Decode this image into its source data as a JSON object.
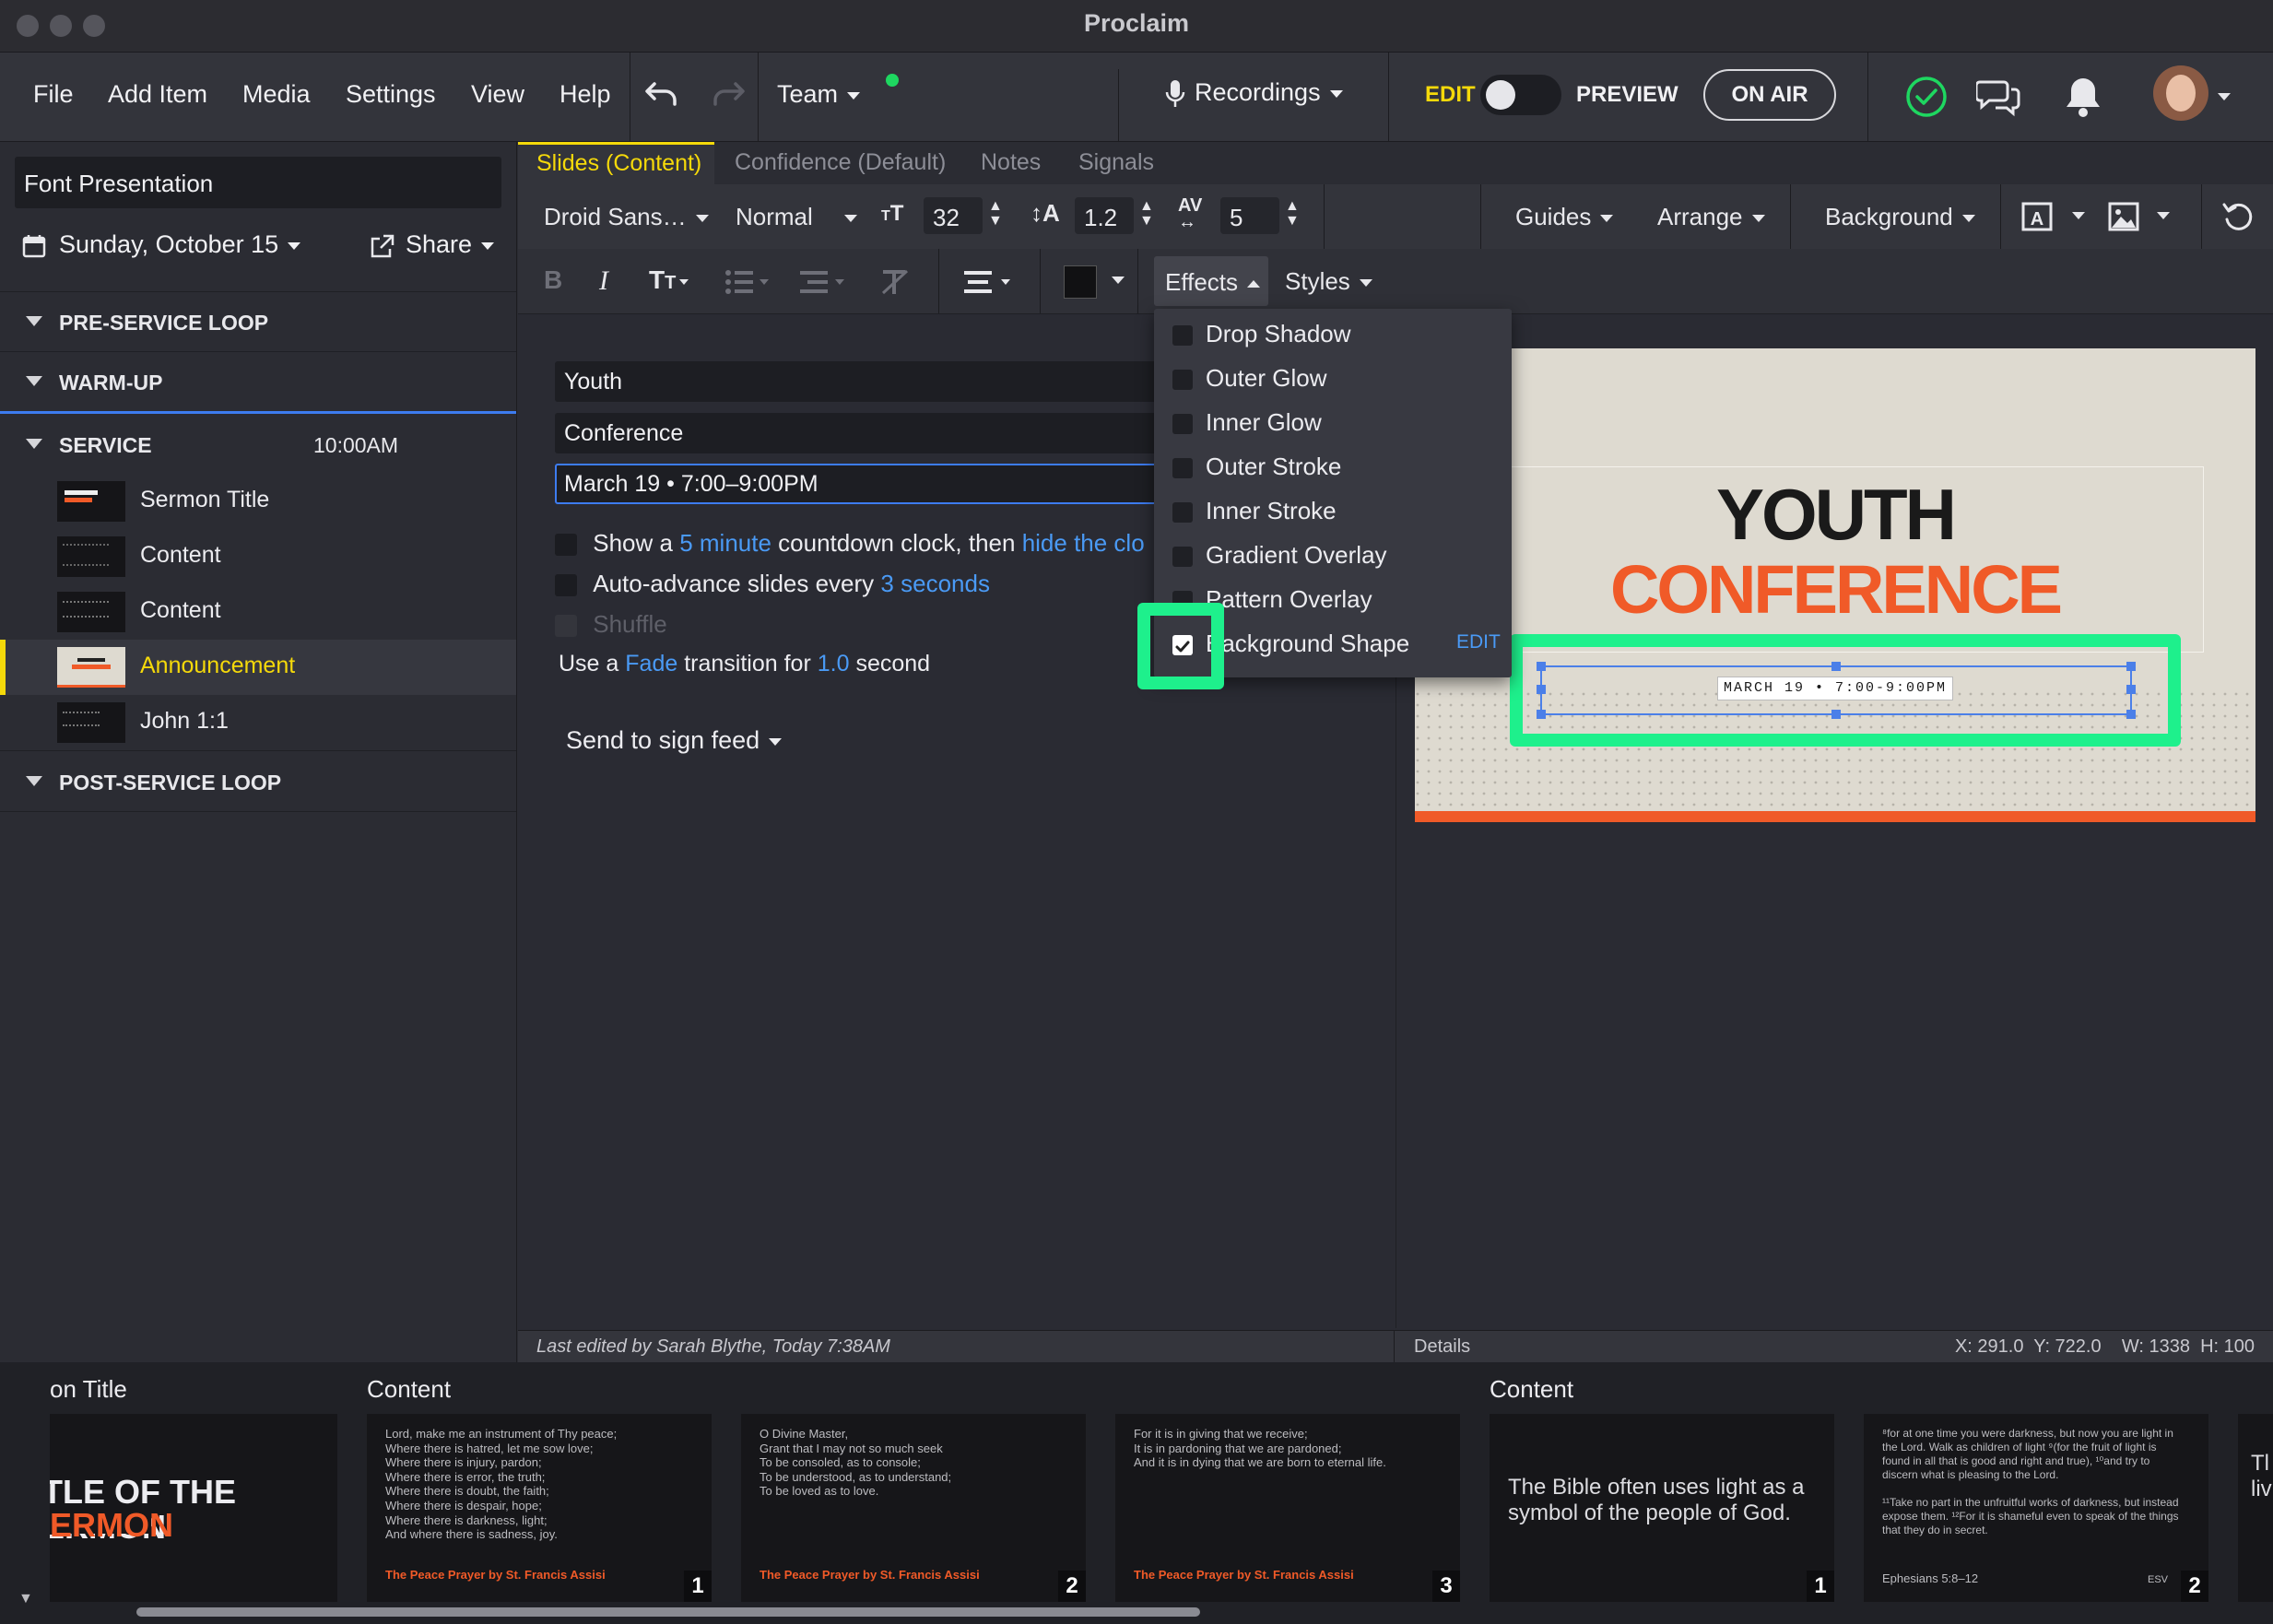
{
  "app": {
    "title": "Proclaim"
  },
  "menu": {
    "items": [
      "File",
      "Add Item",
      "Media",
      "Settings",
      "View",
      "Help"
    ],
    "team_label": "Team",
    "recordings_label": "Recordings",
    "edit_label": "EDIT",
    "preview_label": "PREVIEW",
    "on_air_label": "ON AIR"
  },
  "sidebar": {
    "presentation_name": "Font Presentation",
    "date_label": "Sunday, October 15",
    "share_label": "Share",
    "sections": [
      {
        "label": "PRE-SERVICE LOOP"
      },
      {
        "label": "WARM-UP"
      },
      {
        "label": "SERVICE",
        "time": "10:00AM"
      },
      {
        "label": "POST-SERVICE LOOP"
      }
    ],
    "service_items": [
      {
        "label": "Sermon Title",
        "selected": false
      },
      {
        "label": "Content",
        "selected": false
      },
      {
        "label": "Content",
        "selected": false
      },
      {
        "label": "Announcement",
        "selected": true
      },
      {
        "label": "John 1:1",
        "selected": false
      }
    ]
  },
  "tabs": [
    {
      "label": "Slides (Content)",
      "active": true
    },
    {
      "label": "Confidence (Default)",
      "active": false
    },
    {
      "label": "Notes",
      "active": false
    },
    {
      "label": "Signals",
      "active": false
    }
  ],
  "toolbar": {
    "font_family": "Droid Sans…",
    "font_weight": "Normal",
    "font_size": "32",
    "line_height": "1.2",
    "letter_spacing": "5",
    "guides_label": "Guides",
    "arrange_label": "Arrange",
    "background_label": "Background",
    "effects_label": "Effects",
    "styles_label": "Styles"
  },
  "editor": {
    "fields": [
      "Youth",
      "Conference",
      "March 19 • 7:00–9:00PM"
    ],
    "countdown": {
      "prefix": "Show a",
      "minutes_link": "5 minute",
      "middle": "countdown clock, then",
      "action_link": "hide the clo"
    },
    "auto_advance": {
      "prefix": "Auto-advance slides every",
      "seconds_link": "3 seconds"
    },
    "shuffle_label": "Shuffle",
    "transition": {
      "prefix": "Use a",
      "type_link": "Fade",
      "middle": "transition for",
      "duration_link": "1.0",
      "suffix": "second"
    },
    "send_to_sign_feed": "Send to sign feed"
  },
  "effects_menu": {
    "items": [
      {
        "label": "Drop Shadow",
        "checked": false
      },
      {
        "label": "Outer Glow",
        "checked": false
      },
      {
        "label": "Inner Glow",
        "checked": false
      },
      {
        "label": "Outer Stroke",
        "checked": false
      },
      {
        "label": "Inner Stroke",
        "checked": false
      },
      {
        "label": "Gradient Overlay",
        "checked": false
      },
      {
        "label": "Pattern Overlay",
        "checked": false
      },
      {
        "label": "Background Shape",
        "checked": true
      }
    ],
    "edit_label": "EDIT"
  },
  "slide": {
    "line1": "YOUTH",
    "line2": "CONFERENCE",
    "date_line": "MARCH 19 • 7:00-9:00PM",
    "colors": {
      "accent": "#f05a28",
      "text": "#1a1a1a",
      "background": "#dedad0"
    }
  },
  "status": {
    "last_edited": "Last edited by Sarah Blythe, Today 7:38AM",
    "details_label": "Details",
    "coords": "X: 291.0  Y: 722.0    W: 1338  H: 100"
  },
  "filmstrip": {
    "groups": [
      "on Title",
      "Content",
      "Content"
    ],
    "sermon_title_text": "TLE OF THE\nERMON",
    "slides": [
      {
        "text": "Lord, make me an instrument of Thy peace;\nWhere there is hatred, let me sow love;\nWhere there is injury, pardon;\nWhere there is error, the truth;\nWhere there is doubt, the faith;\nWhere there is despair, hope;\nWhere there is darkness, light;\nAnd where there is sadness, joy.",
        "footer": "The Peace Prayer by St. Francis Assisi",
        "num": "1"
      },
      {
        "text": "O Divine Master,\nGrant that I may not so much seek\nTo be consoled, as to console;\nTo be understood, as to understand;\nTo be loved as to love.",
        "footer": "The Peace Prayer by St. Francis Assisi",
        "num": "2"
      },
      {
        "text": "For it is in giving that we receive;\nIt is in pardoning that we are pardoned;\nAnd it is in dying that we are born to eternal life.",
        "footer": "The Peace Prayer by St. Francis Assisi",
        "num": "3"
      },
      {
        "text": "The Bible often uses light as a symbol of the people of God.",
        "footer": "",
        "num": "1"
      },
      {
        "text": "⁸for at one time you were darkness, but now you are light in the Lord. Walk as children of light ⁹(for the fruit of light is found in all that is good and right and true), ¹⁰and try to discern what is pleasing to the Lord.\n\n¹¹Take no part in the unfruitful works of darkness, but instead expose them. ¹²For it is shameful even to speak of the things that they do in secret.",
        "footer": "Ephesians 5:8–12",
        "version": "ESV",
        "num": "2"
      }
    ],
    "last_partial_text": "Tl\nliv"
  }
}
